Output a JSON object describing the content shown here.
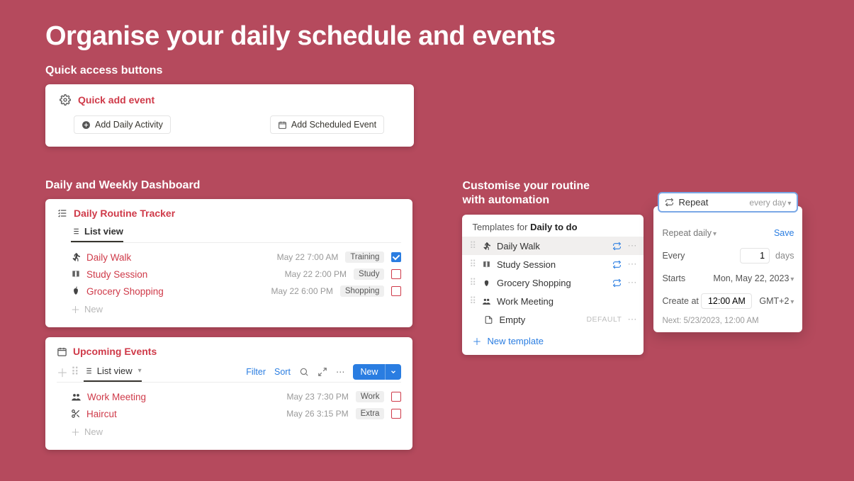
{
  "hero": {
    "title": "Organise your daily schedule and events"
  },
  "sections": {
    "quick_access": "Quick access buttons",
    "dashboard": "Daily and Weekly Dashboard",
    "automation_l1": "Customise your routine",
    "automation_l2": "with automation"
  },
  "quick_add": {
    "title": "Quick add event",
    "btn_activity": "Add Daily Activity",
    "btn_scheduled": "Add Scheduled Event"
  },
  "daily": {
    "title": "Daily Routine Tracker",
    "tab": "List view",
    "items": [
      {
        "icon": "walk",
        "title": "Daily Walk",
        "time": "May 22 7:00 AM",
        "tag": "Training",
        "checked": true
      },
      {
        "icon": "book",
        "title": "Study Session",
        "time": "May 22 2:00 PM",
        "tag": "Study",
        "checked": false
      },
      {
        "icon": "apple",
        "title": "Grocery Shopping",
        "time": "May 22 6:00 PM",
        "tag": "Shopping",
        "checked": false
      }
    ],
    "new": "New"
  },
  "upcoming": {
    "title": "Upcoming Events",
    "tab": "List view",
    "toolbar": {
      "filter": "Filter",
      "sort": "Sort",
      "new": "New"
    },
    "items": [
      {
        "icon": "people",
        "title": "Work Meeting",
        "time": "May 23 7:30 PM",
        "tag": "Work"
      },
      {
        "icon": "scissors",
        "title": "Haircut",
        "time": "May 26 3:15 PM",
        "tag": "Extra"
      }
    ],
    "new": "New"
  },
  "templates": {
    "header_prefix": "Templates for ",
    "header_bold": "Daily to do",
    "items": [
      {
        "icon": "walk",
        "label": "Daily Walk",
        "repeat": true,
        "default": false,
        "selected": true
      },
      {
        "icon": "book",
        "label": "Study Session",
        "repeat": true,
        "default": false,
        "selected": false
      },
      {
        "icon": "apple",
        "label": "Grocery Shopping",
        "repeat": true,
        "default": false,
        "selected": false
      },
      {
        "icon": "people",
        "label": "Work Meeting",
        "repeat": false,
        "default": false,
        "selected": false
      },
      {
        "icon": "file",
        "label": "Empty",
        "repeat": false,
        "default": true,
        "selected": false
      }
    ],
    "default_label": "DEFAULT",
    "new_template": "New template"
  },
  "repeat": {
    "pill_label": "Repeat",
    "pill_value": "every day",
    "mode": "Repeat daily",
    "save": "Save",
    "every_label": "Every",
    "every_value": "1",
    "every_unit": "days",
    "starts_label": "Starts",
    "starts_value": "Mon, May 22, 2023",
    "create_label": "Create at",
    "create_value": "12:00 AM",
    "tz": "GMT+2",
    "next": "Next: 5/23/2023, 12:00 AM"
  }
}
